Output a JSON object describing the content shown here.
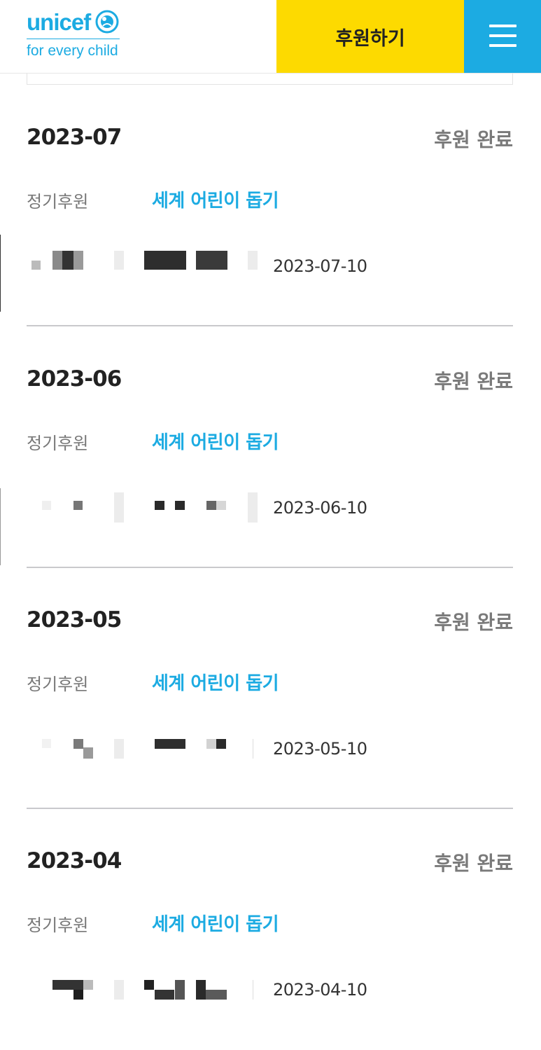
{
  "header": {
    "logo_text": "unicef",
    "logo_tagline": "for every child",
    "donate_label": "후원하기",
    "menu_icon": "hamburger-menu-icon",
    "colors": {
      "brand_blue": "#1cabe2",
      "donate_yellow": "#fdda00"
    }
  },
  "records": [
    {
      "month": "2023-07",
      "status": "후원 완료",
      "type": "정기후원",
      "campaign": "세계 어린이 돕기",
      "date": "2023-07-10"
    },
    {
      "month": "2023-06",
      "status": "후원 완료",
      "type": "정기후원",
      "campaign": "세계 어린이 돕기",
      "date": "2023-06-10"
    },
    {
      "month": "2023-05",
      "status": "후원 완료",
      "type": "정기후원",
      "campaign": "세계 어린이 돕기",
      "date": "2023-05-10"
    },
    {
      "month": "2023-04",
      "status": "후원 완료",
      "type": "정기후원",
      "campaign": "세계 어린이 돕기",
      "date": "2023-04-10"
    }
  ]
}
